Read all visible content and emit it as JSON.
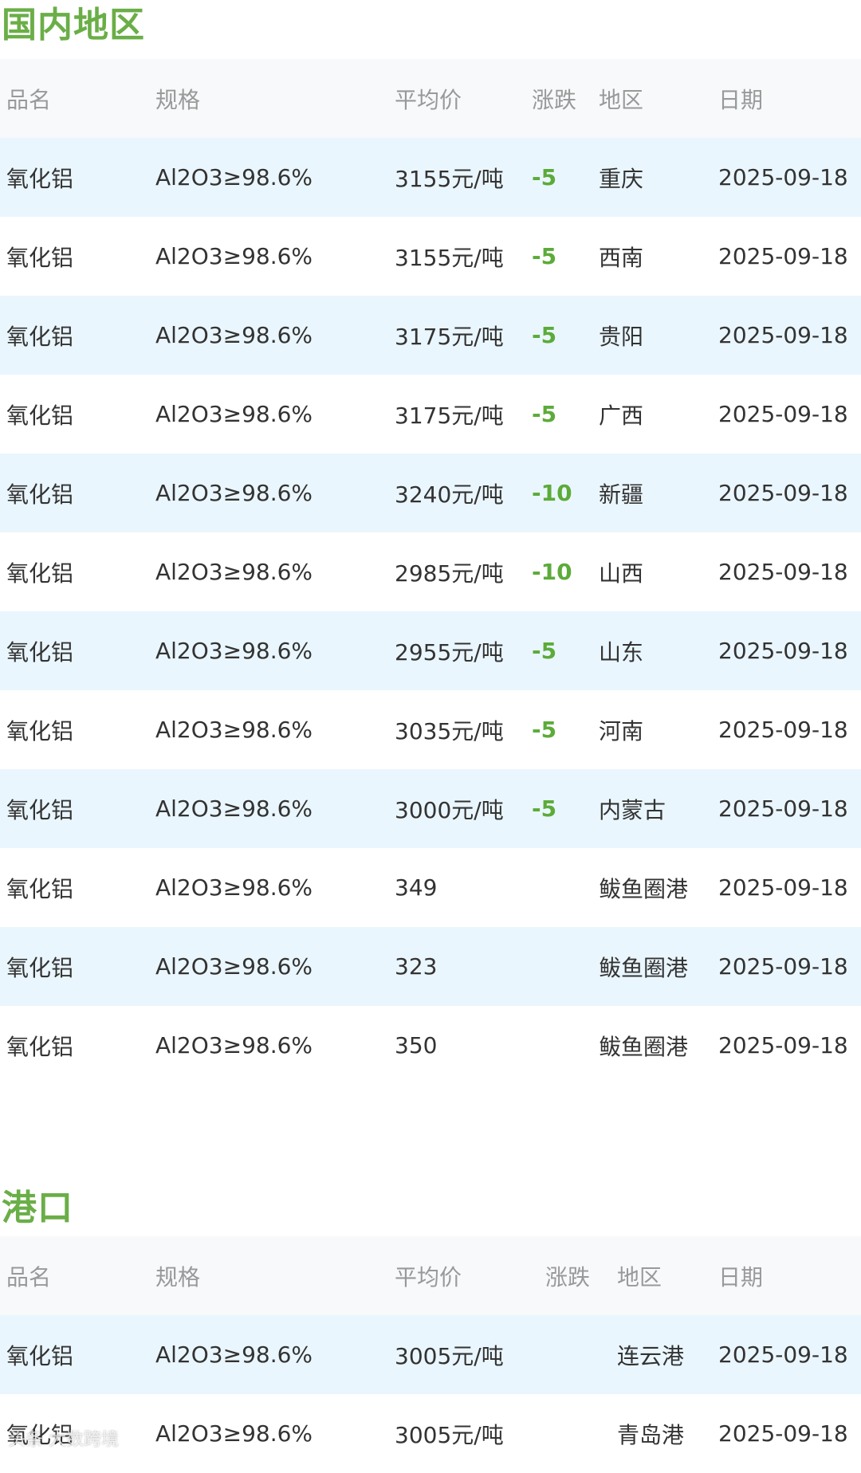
{
  "domestic": {
    "title": "国内地区",
    "headers": [
      "品名",
      "规格",
      "平均价",
      "涨跌",
      "地区",
      "日期"
    ],
    "rows": [
      {
        "name": "氧化铝",
        "spec": "Al2O3≥98.6%",
        "price": "3155元/吨",
        "change": "-5",
        "region": "重庆",
        "date": "2025-09-18"
      },
      {
        "name": "氧化铝",
        "spec": "Al2O3≥98.6%",
        "price": "3155元/吨",
        "change": "-5",
        "region": "西南",
        "date": "2025-09-18"
      },
      {
        "name": "氧化铝",
        "spec": "Al2O3≥98.6%",
        "price": "3175元/吨",
        "change": "-5",
        "region": "贵阳",
        "date": "2025-09-18"
      },
      {
        "name": "氧化铝",
        "spec": "Al2O3≥98.6%",
        "price": "3175元/吨",
        "change": "-5",
        "region": "广西",
        "date": "2025-09-18"
      },
      {
        "name": "氧化铝",
        "spec": "Al2O3≥98.6%",
        "price": "3240元/吨",
        "change": "-10",
        "region": "新疆",
        "date": "2025-09-18"
      },
      {
        "name": "氧化铝",
        "spec": "Al2O3≥98.6%",
        "price": "2985元/吨",
        "change": "-10",
        "region": "山西",
        "date": "2025-09-18"
      },
      {
        "name": "氧化铝",
        "spec": "Al2O3≥98.6%",
        "price": "2955元/吨",
        "change": "-5",
        "region": "山东",
        "date": "2025-09-18"
      },
      {
        "name": "氧化铝",
        "spec": "Al2O3≥98.6%",
        "price": "3035元/吨",
        "change": "-5",
        "region": "河南",
        "date": "2025-09-18"
      },
      {
        "name": "氧化铝",
        "spec": "Al2O3≥98.6%",
        "price": "3000元/吨",
        "change": "-5",
        "region": "内蒙古",
        "date": "2025-09-18"
      },
      {
        "name": "氧化铝",
        "spec": "Al2O3≥98.6%",
        "price": "349",
        "change": "",
        "region": "鲅鱼圈港",
        "date": "2025-09-18"
      },
      {
        "name": "氧化铝",
        "spec": "Al2O3≥98.6%",
        "price": "323",
        "change": "",
        "region": "鲅鱼圈港",
        "date": "2025-09-18"
      },
      {
        "name": "氧化铝",
        "spec": "Al2O3≥98.6%",
        "price": "350",
        "change": "",
        "region": "鲅鱼圈港",
        "date": "2025-09-18"
      }
    ]
  },
  "port": {
    "title": "港口",
    "headers": [
      "品名",
      "规格",
      "平均价",
      "涨跌",
      "地区",
      "日期"
    ],
    "rows": [
      {
        "name": "氧化铝",
        "spec": "Al2O3≥98.6%",
        "price": "3005元/吨",
        "change": "",
        "region": "连云港",
        "date": "2025-09-18"
      },
      {
        "name": "氧化铝",
        "spec": "Al2O3≥98.6%",
        "price": "3005元/吨",
        "change": "",
        "region": "青岛港",
        "date": "2025-09-18"
      }
    ]
  },
  "watermark": "头条 大数跨境",
  "colors": {
    "accent_green": "#6aae47",
    "change_green": "#5cab3a",
    "stripe": "#eaf6fd",
    "header_bg": "#f7f9fb"
  }
}
